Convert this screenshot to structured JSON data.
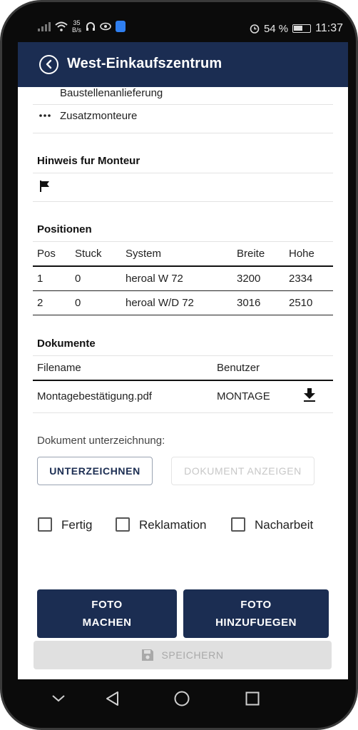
{
  "status_bar": {
    "net_speed_value": "35",
    "net_speed_unit": "B/s",
    "battery": "54 %",
    "time": "11:37"
  },
  "app_bar": {
    "title": "West-Einkaufszentrum",
    "back_icon": "chevron-left-circle-icon"
  },
  "top_list": {
    "item1": "Baustellenanlieferung",
    "item2_icon": "more-horizontal-icon",
    "item2": "Zusatzmonteure"
  },
  "hinweis": {
    "title": "Hinweis fur Monteur",
    "icon": "flag-icon"
  },
  "positionen": {
    "title": "Positionen",
    "headers": [
      "Pos",
      "Stuck",
      "System",
      "Breite",
      "Hohe"
    ],
    "rows": [
      [
        "1",
        "0",
        "heroal W 72",
        "3200",
        "2334"
      ],
      [
        "2",
        "0",
        "heroal W/D 72",
        "3016",
        "2510"
      ]
    ]
  },
  "dokumente": {
    "title": "Dokumente",
    "headers": [
      "Filename",
      "Benutzer"
    ],
    "rows": [
      {
        "filename": "Montagebestätigung.pdf",
        "benutzer": "MONTAGE",
        "action_icon": "download-icon"
      }
    ]
  },
  "signing": {
    "label": "Dokument unterzeichnung:",
    "sign_button": "UNTERZEICHNEN",
    "show_button": "DOKUMENT ANZEIGEN"
  },
  "checkboxes": [
    {
      "label": "Fertig",
      "checked": false
    },
    {
      "label": "Reklamation",
      "checked": false
    },
    {
      "label": "Nacharbeit",
      "checked": false
    }
  ],
  "actions": {
    "foto_machen": [
      "FOTO",
      "MACHEN"
    ],
    "foto_hinzufuegen": [
      "FOTO",
      "HINZUFUEGEN"
    ],
    "save": "SPEICHERN",
    "save_icon": "save-icon"
  },
  "colors": {
    "primary": "#1b2d52",
    "disabled_text": "#c7c7c7"
  }
}
